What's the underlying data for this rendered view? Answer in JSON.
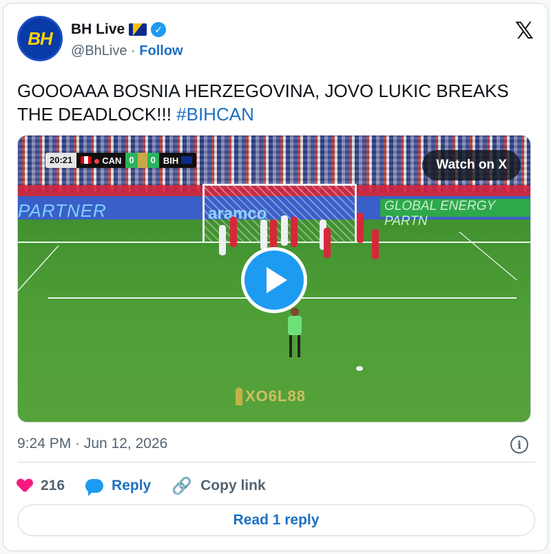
{
  "author": {
    "avatar_text": "BH",
    "display_name": "BH Live",
    "flag_icon": "bosnia-flag-icon",
    "verified_icon": "verified-badge-icon",
    "handle": "@BhLive",
    "separator": "·",
    "follow_label": "Follow"
  },
  "platform_logo": "𝕏",
  "tweet": {
    "text": "GOOOAAA BOSNIA HERZEGOVINA, JOVO LUKIC BREAKS THE DEADLOCK!!! ",
    "hashtag": "#BIHCAN"
  },
  "media": {
    "watch_label": "Watch on X",
    "scorebug": {
      "time": "20:21",
      "team1": "CAN",
      "score1": "0",
      "score2": "0",
      "team2": "BIH"
    },
    "board_left": "PARTNER",
    "board_right": "GLOBAL ENERGY PARTN",
    "goal_sponsor": "aramco",
    "watermark": "XO6L88"
  },
  "timestamp": "9:24 PM · Jun 12, 2026",
  "actions": {
    "like_count": "216",
    "reply_label": "Reply",
    "copy_link_label": "Copy link",
    "link_icon_glyph": "🔗"
  },
  "read_reply_label": "Read 1 reply",
  "colors": {
    "accent": "#1d9bf0",
    "link": "#1d6fc2",
    "like": "#f91880",
    "muted": "#536471"
  }
}
